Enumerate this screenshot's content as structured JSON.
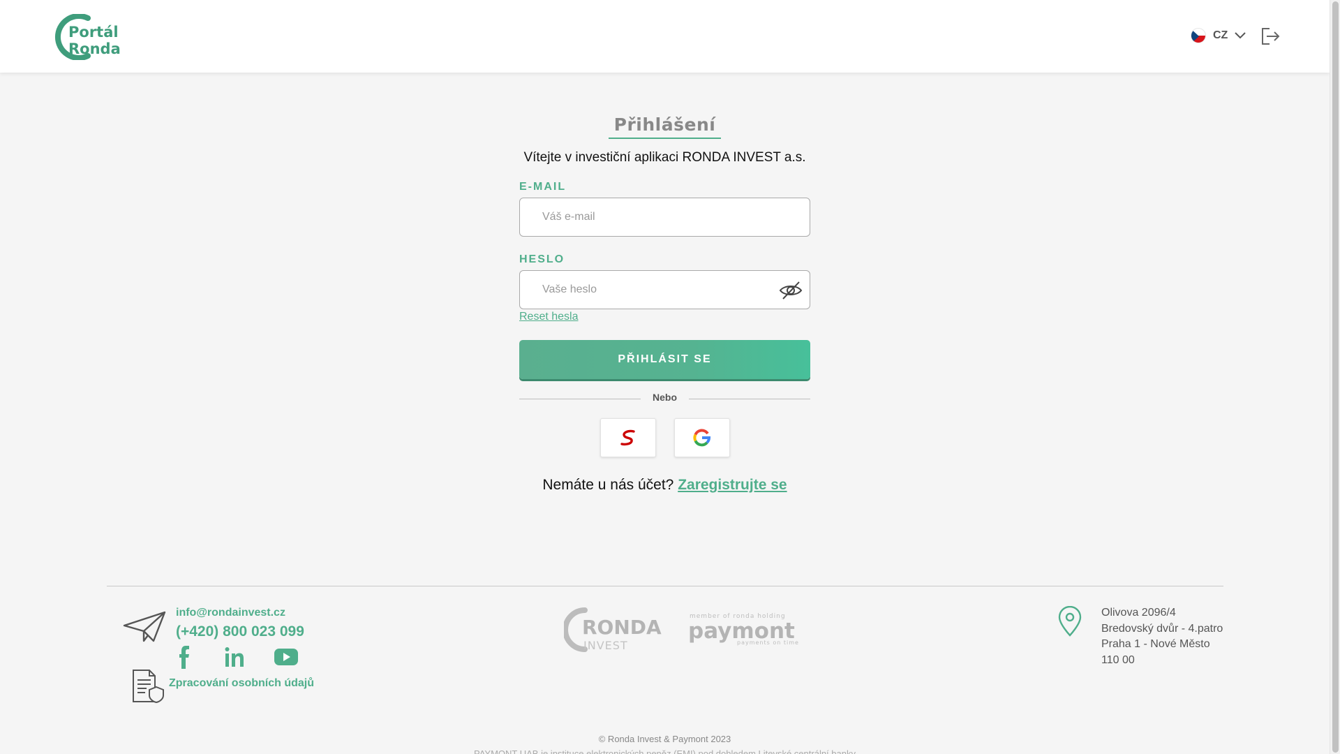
{
  "header": {
    "logo_line1": "Portál",
    "logo_line2": "Ronda",
    "language": "CZ",
    "brand_color": "#4fae8b"
  },
  "login": {
    "title": "Přihlášení",
    "welcome": "Vítejte v investiční aplikaci RONDA INVEST a.s.",
    "email_label": "E-MAIL",
    "email_placeholder": "Váš e-mail",
    "email_value": "",
    "password_label": "HESLO",
    "password_placeholder": "Vaše heslo",
    "password_value": "",
    "reset_link": "Reset hesla",
    "submit_label": "PŘIHLÁSIT SE",
    "divider_text": "Nebo",
    "social_providers": [
      "seznam-icon",
      "google-icon"
    ],
    "register_question": "Nemáte u nás účet?",
    "register_link": "Zaregistrujte se"
  },
  "footer": {
    "email": "info@rondainvest.cz",
    "phone": "(+420) 800 023 099",
    "social_icons": [
      "facebook-icon",
      "linkedin-icon",
      "youtube-icon"
    ],
    "gdpr_link": "Zpracování osobních údajů",
    "partner_logos": {
      "ronda_line1": "RONDA",
      "ronda_line2": "INVEST",
      "payment_tagline": "member of ronda holding",
      "payment_name": "paymont",
      "payment_subline": "payments on time"
    },
    "address": {
      "line1": "Olivova 2096/4",
      "line2": "Bredovský dvůr - 4.patro",
      "line3": "Praha 1 - Nové Město",
      "line4": "110 00"
    },
    "copyright": "© Ronda Invest & Paymont 2023",
    "legal_note": "PAYMONT UAB je instituce elektronických peněz (EMI) pod dohledem Litevské centrální banky"
  }
}
